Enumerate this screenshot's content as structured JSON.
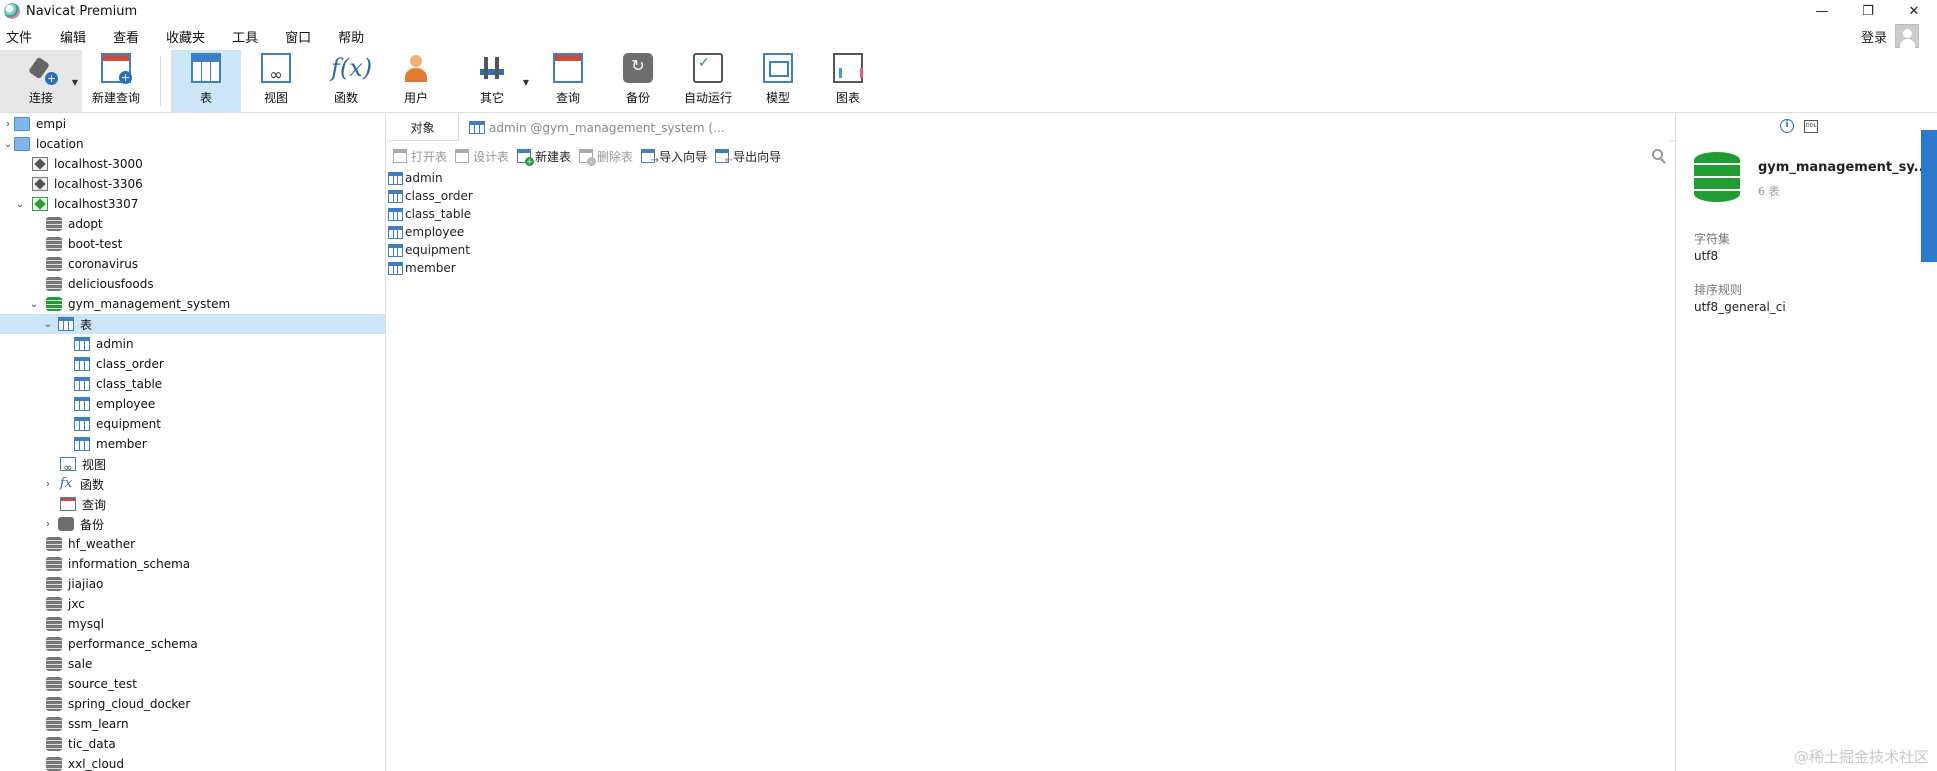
{
  "window": {
    "title": "Navicat Premium",
    "minimize": "—",
    "restore": "❐",
    "close": "✕"
  },
  "menu": [
    "文件",
    "编辑",
    "查看",
    "收藏夹",
    "工具",
    "窗口",
    "帮助"
  ],
  "login_label": "登录",
  "toolbar": {
    "connect": "连接",
    "new_query": "新建查询",
    "table": "表",
    "view": "视图",
    "function": "函数",
    "user": "用户",
    "other": "其它",
    "query": "查询",
    "backup": "备份",
    "automation": "自动运行",
    "model": "模型",
    "chart": "图表"
  },
  "tree": {
    "empi": "empi",
    "location": "location",
    "localhost_3000": "localhost-3000",
    "localhost_3306": "localhost-3306",
    "localhost3307": "localhost3307",
    "dbs_before": [
      "adopt",
      "boot-test",
      "coronavirus",
      "deliciousfoods"
    ],
    "gym": "gym_management_system",
    "tables_node": "表",
    "tables": [
      "admin",
      "class_order",
      "class_table",
      "employee",
      "equipment",
      "member"
    ],
    "views_node": "视图",
    "functions_node": "函数",
    "queries_node": "查询",
    "backups_node": "备份",
    "dbs_after": [
      "hf_weather",
      "information_schema",
      "jiajiao",
      "jxc",
      "mysql",
      "performance_schema",
      "sale",
      "source_test",
      "spring_cloud_docker",
      "ssm_learn",
      "tic_data",
      "xxl_cloud"
    ]
  },
  "main": {
    "objects_tab": "对象",
    "doc_tab": "admin @gym_management_system (...",
    "open_table": "打开表",
    "design_table": "设计表",
    "new_table": "新建表",
    "delete_table": "删除表",
    "import_wizard": "导入向导",
    "export_wizard": "导出向导",
    "objects": [
      "admin",
      "class_order",
      "class_table",
      "employee",
      "equipment",
      "member"
    ]
  },
  "info": {
    "db_name": "gym_management_sy...",
    "count": "6 表",
    "charset_label": "字符集",
    "charset_value": "utf8",
    "collation_label": "排序规则",
    "collation_value": "utf8_general_ci",
    "ddl": "DDL"
  },
  "watermark": "@稀土掘金技术社区"
}
